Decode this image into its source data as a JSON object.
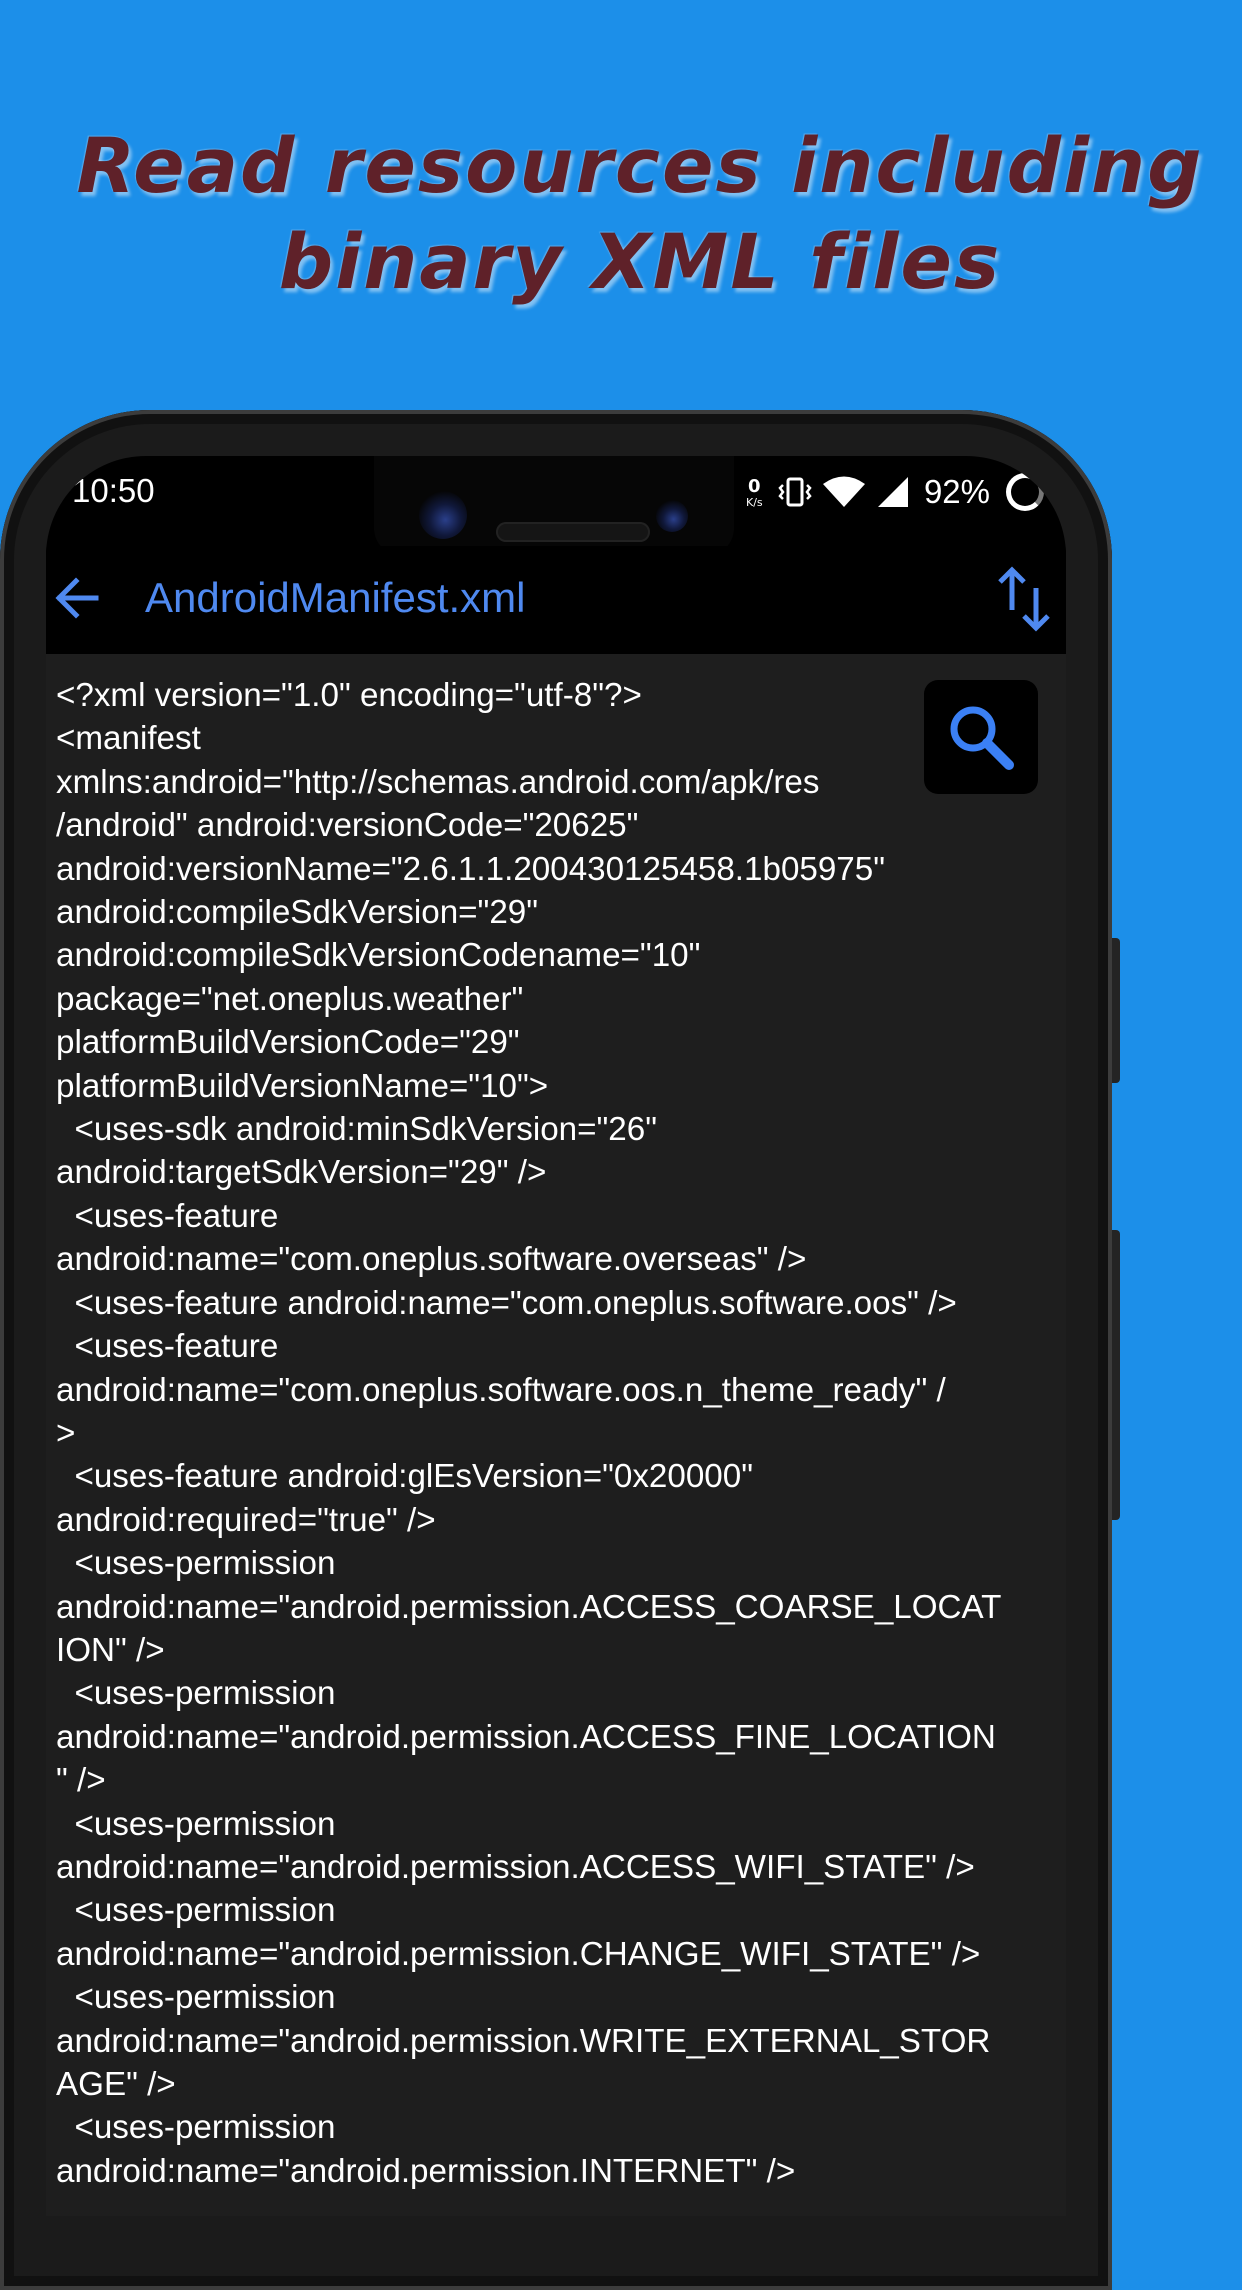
{
  "headline": {
    "line1": "Read resources including",
    "line2": "binary XML files"
  },
  "status_bar": {
    "time": "10:50",
    "battery_percent": "92%",
    "icons": [
      "data-rate-icon",
      "vibrate-icon",
      "wifi-icon",
      "signal-icon",
      "battery-saver-icon"
    ]
  },
  "toolbar": {
    "title": "AndroidManifest.xml",
    "back_icon": "arrow-left-icon",
    "sort_icon": "swap-vertical-icon",
    "accent": "#4f89f0"
  },
  "search_button": {
    "icon": "search-icon",
    "color": "#3b80f5"
  },
  "code_lines": [
    "<?xml version=\"1.0\" encoding=\"utf-8\"?>",
    "<manifest",
    "xmlns:android=\"http://schemas.android.com/apk/res",
    "/android\" android:versionCode=\"20625\"",
    "android:versionName=\"2.6.1.1.200430125458.1b05975\"",
    "android:compileSdkVersion=\"29\"",
    "android:compileSdkVersionCodename=\"10\"",
    "package=\"net.oneplus.weather\"",
    "platformBuildVersionCode=\"29\"",
    "platformBuildVersionName=\"10\">",
    "  <uses-sdk android:minSdkVersion=\"26\"",
    "android:targetSdkVersion=\"29\" />",
    "  <uses-feature",
    "android:name=\"com.oneplus.software.overseas\" />",
    "  <uses-feature android:name=\"com.oneplus.software.oos\" />",
    "  <uses-feature",
    "android:name=\"com.oneplus.software.oos.n_theme_ready\" /",
    ">",
    "  <uses-feature android:glEsVersion=\"0x20000\"",
    "android:required=\"true\" />",
    "  <uses-permission",
    "android:name=\"android.permission.ACCESS_COARSE_LOCAT",
    "ION\" />",
    "  <uses-permission",
    "android:name=\"android.permission.ACCESS_FINE_LOCATION",
    "\" />",
    "  <uses-permission",
    "android:name=\"android.permission.ACCESS_WIFI_STATE\" />",
    "  <uses-permission",
    "android:name=\"android.permission.CHANGE_WIFI_STATE\" />",
    "  <uses-permission",
    "android:name=\"android.permission.WRITE_EXTERNAL_STOR",
    "AGE\" />",
    "  <uses-permission",
    "android:name=\"android.permission.INTERNET\" />"
  ],
  "colors": {
    "background": "#1c8fe9",
    "headline": "#5f2129",
    "content_bg": "#1e1e1e",
    "code_text": "#ffffff"
  }
}
